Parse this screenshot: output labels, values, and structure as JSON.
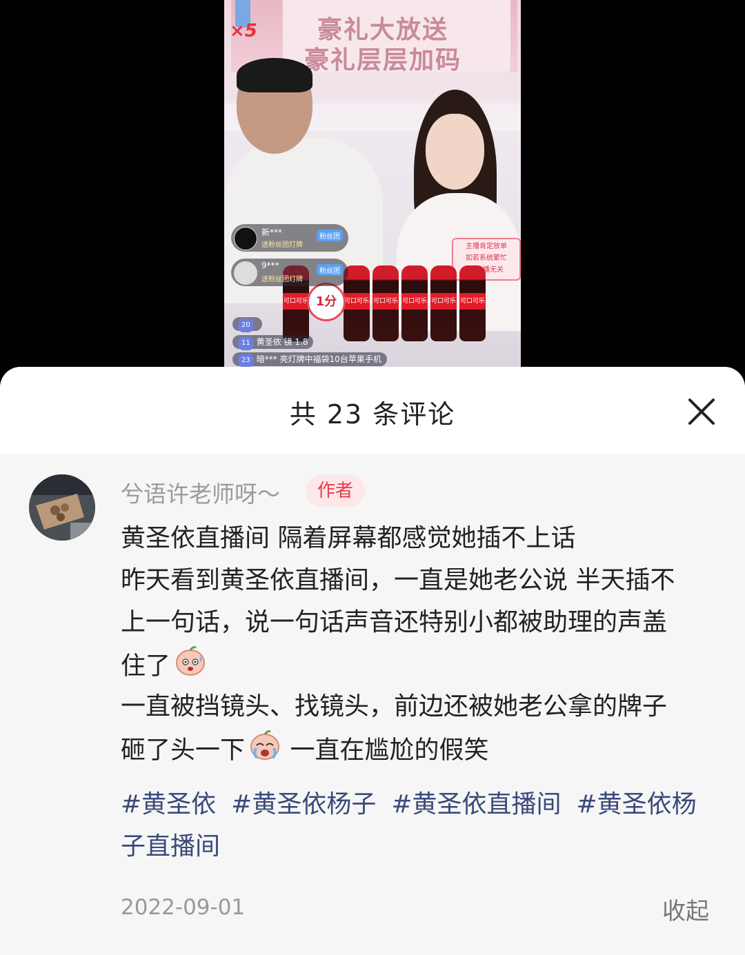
{
  "video": {
    "banner_line1": "豪礼大放送",
    "banner_line2": "豪礼层层加码",
    "multiplier": "×5",
    "sign_lines": [
      "主播肯定放单",
      "如若系统繁忙",
      "与主播无关"
    ],
    "price_badge": "1分",
    "bottle_label": "可口可乐",
    "fan_cards": [
      {
        "name": "新***",
        "sub": "送粉丝团灯牌",
        "tag": "粉丝团"
      },
      {
        "name": "9***",
        "sub": "送粉丝团灯牌",
        "tag": "粉丝团"
      }
    ],
    "chat_rows": [
      {
        "level": "20",
        "text": ""
      },
      {
        "level": "11",
        "text": "黄圣依 镜 1.8"
      },
      {
        "level": "23",
        "text": "暗*** 亮灯牌中福袋10台苹果手机"
      }
    ]
  },
  "sheet": {
    "title": "共 23 条评论",
    "close_icon": "close-icon"
  },
  "comment": {
    "author": "兮语许老师呀～",
    "badge": "作者",
    "lines": [
      "黄圣依直播间 隔着屏幕都感觉她插不上话",
      "昨天看到黄圣依直播间，一直是她老公说 半天插不",
      "上一句话，说一句话声音还特别小都被助理的声盖",
      "住了",
      "一直被挡镜头、找镜头，前边还被她老公拿的牌子",
      "砸了头一下",
      "一直在尴尬的假笑"
    ],
    "tags_line1": [
      "#黄圣依",
      "#黄圣依杨子",
      "#黄圣依直播间",
      "#黄圣依杨"
    ],
    "tags_line2": "子直播间",
    "date": "2022-09-01",
    "collapse": "收起"
  }
}
